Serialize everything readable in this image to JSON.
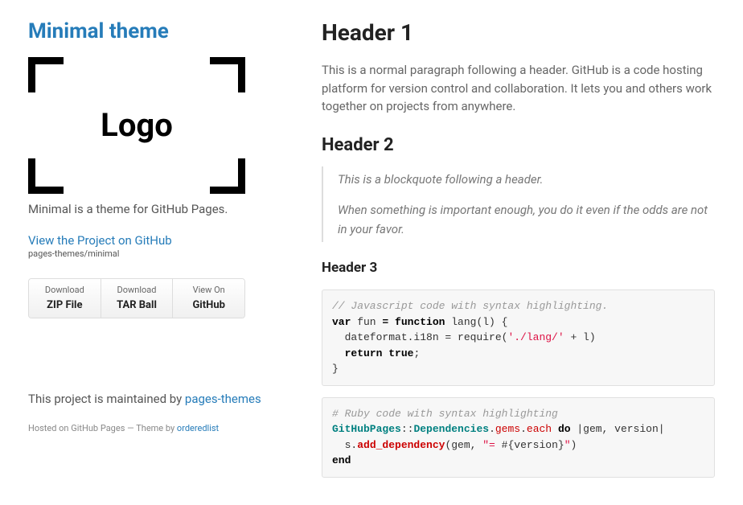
{
  "sidebar": {
    "title": "Minimal theme",
    "logo_text": "Logo",
    "tagline": "Minimal is a theme for GitHub Pages.",
    "github_link": "View the Project on GitHub",
    "github_slug": "pages-themes/minimal",
    "buttons": [
      {
        "small": "Download",
        "big": "ZIP File"
      },
      {
        "small": "Download",
        "big": "TAR Ball"
      },
      {
        "small": "View On",
        "big": "GitHub"
      }
    ],
    "maintained_prefix": "This project is maintained by ",
    "maintained_link": "pages-themes",
    "hosted_prefix": "Hosted on GitHub Pages — Theme by ",
    "hosted_link": "orderedlist"
  },
  "content": {
    "h1": "Header 1",
    "p1": "This is a normal paragraph following a header. GitHub is a code hosting platform for version control and collaboration. It lets you and others work together on projects from anywhere.",
    "h2": "Header 2",
    "bq1": "This is a blockquote following a header.",
    "bq2": "When something is important enough, you do it even if the odds are not in your favor.",
    "h3": "Header 3",
    "js": {
      "c": "// Javascript code with syntax highlighting.",
      "l1a": "var",
      "l1b": " fun ",
      "l1c": "=",
      "l1d": " function",
      "l1e": " lang(l) {",
      "l2a": "  dateformat.i18n = require(",
      "l2b": "'./lang/'",
      "l2c": " + l)",
      "l3a": "  ",
      "l3b": "return true",
      "l3c": ";",
      "l4": "}"
    },
    "rb": {
      "c": "# Ruby code with syntax highlighting",
      "l1a": "GitHubPages",
      "l1b": "::",
      "l1c": "Dependencies",
      "l1d": ".",
      "l1e": "gems",
      "l1f": ".",
      "l1g": "each",
      "l1h": " ",
      "l1i": "do",
      "l1j": " |gem, version|",
      "l2a": "  s.",
      "l2b": "add_dependency",
      "l2c": "(gem, ",
      "l2d": "\"= ",
      "l2e": "#{",
      "l2f": "version",
      "l2g": "}",
      "l2h": "\"",
      "l2i": ")",
      "l3": "end"
    }
  }
}
